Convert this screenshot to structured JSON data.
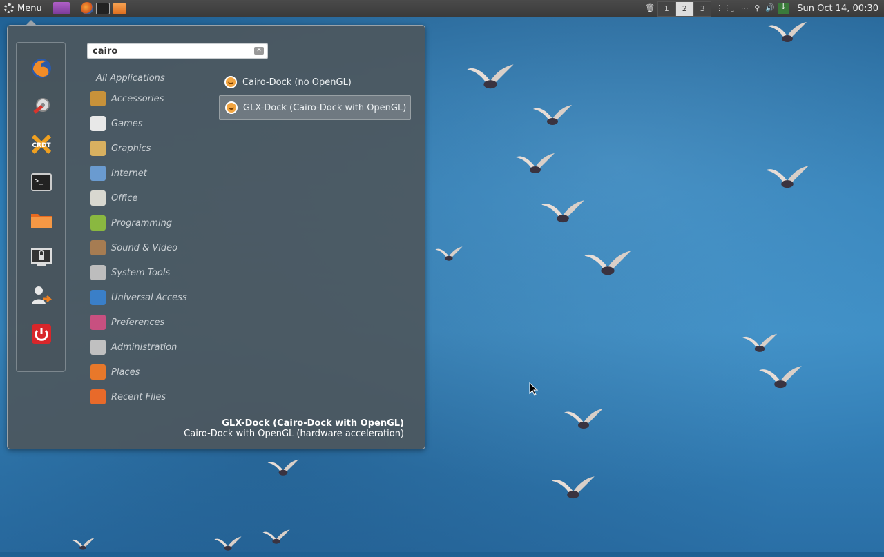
{
  "panel": {
    "menu_label": "Menu",
    "workspaces": [
      "1",
      "2",
      "3"
    ],
    "active_workspace": "2",
    "clock": "Sun Oct 14, 00:30",
    "launchers": [
      "video-icon",
      "firefox-icon",
      "terminal-icon",
      "folder-icon"
    ]
  },
  "search": {
    "value": "cairo",
    "placeholder": ""
  },
  "menu": {
    "all_applications": "All Applications",
    "categories": [
      {
        "label": "Accessories",
        "icon": "accessories-icon",
        "color": "#c8923a"
      },
      {
        "label": "Games",
        "icon": "games-icon",
        "color": "#e8e8e8"
      },
      {
        "label": "Graphics",
        "icon": "graphics-icon",
        "color": "#d8b060"
      },
      {
        "label": "Internet",
        "icon": "internet-icon",
        "color": "#6a9bd0"
      },
      {
        "label": "Office",
        "icon": "office-icon",
        "color": "#d8d8d0"
      },
      {
        "label": "Programming",
        "icon": "programming-icon",
        "color": "#8ab840"
      },
      {
        "label": "Sound & Video",
        "icon": "sound-video-icon",
        "color": "#a67c52"
      },
      {
        "label": "System Tools",
        "icon": "system-tools-icon",
        "color": "#bdbdbd"
      },
      {
        "label": "Universal Access",
        "icon": "universal-access-icon",
        "color": "#3a7fc8"
      },
      {
        "label": "Preferences",
        "icon": "preferences-icon",
        "color": "#c85080"
      },
      {
        "label": "Administration",
        "icon": "administration-icon",
        "color": "#c0c0c0"
      },
      {
        "label": "Places",
        "icon": "places-icon",
        "color": "#e8782a"
      },
      {
        "label": "Recent Files",
        "icon": "recent-files-icon",
        "color": "#e86a2a"
      }
    ],
    "results": [
      {
        "label": "Cairo-Dock (no OpenGL)",
        "selected": false
      },
      {
        "label": "GLX-Dock (Cairo-Dock with OpenGL)",
        "selected": true
      }
    ],
    "description": {
      "title": "GLX-Dock (Cairo-Dock with OpenGL)",
      "text": "Cairo-Dock with OpenGL (hardware acceleration)"
    },
    "favorites": [
      "firefox-icon",
      "settings-icon",
      "crunchbang-icon",
      "terminal-icon",
      "folder-icon",
      "lock-screen-icon",
      "logout-icon",
      "power-icon"
    ]
  }
}
